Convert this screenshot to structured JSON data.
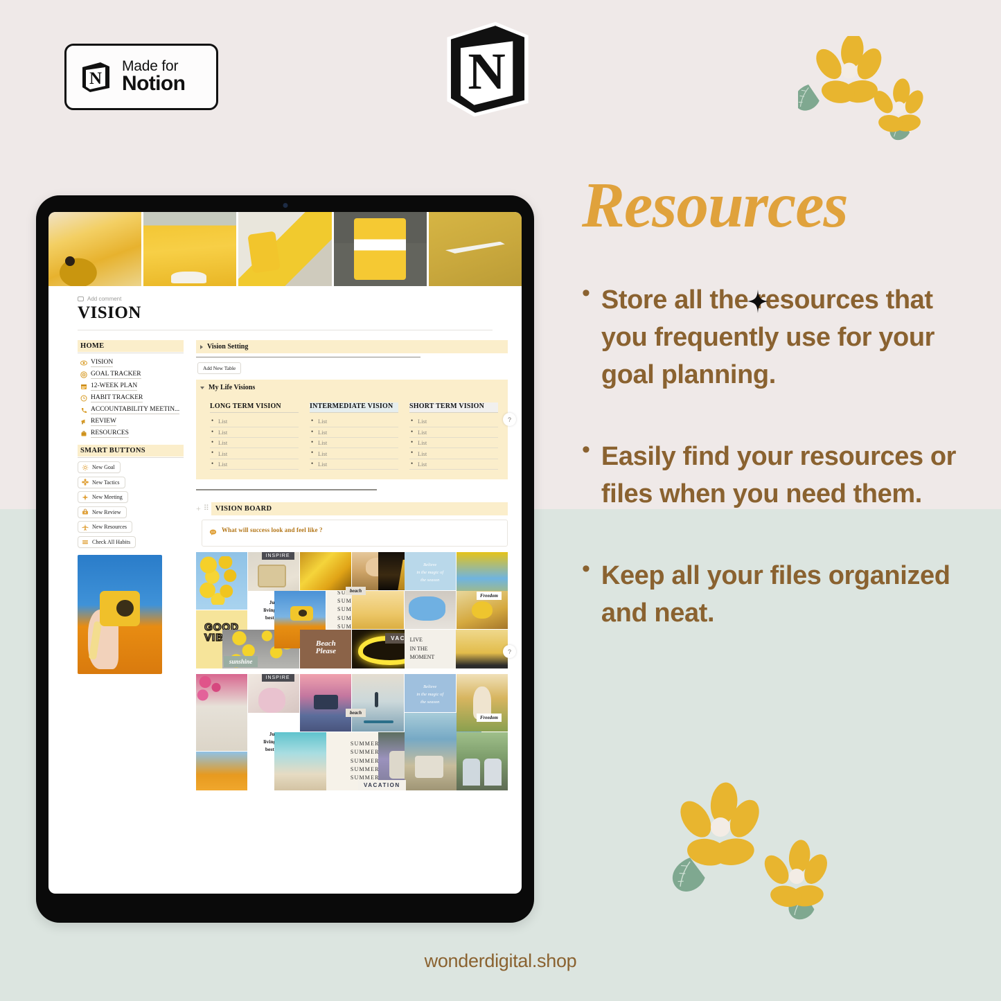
{
  "badge": {
    "line1": "Made for",
    "line2": "Notion",
    "icon": "notion-cube-icon"
  },
  "logo": {
    "icon": "notion-logo-icon"
  },
  "decor": {
    "flowers_top": "flower-pair-icon",
    "flowers_bottom": "flower-pair-icon",
    "sparkle": "four-point-star-icon"
  },
  "colors": {
    "bg_top": "#efe9e8",
    "bg_bottom": "#dce5e0",
    "accent_orange": "#e0a23c",
    "text_brown": "#8a6230",
    "notion_highlight": "#fbeecb"
  },
  "tablet": {
    "cover_images": [
      "yellow-ukulele-photo",
      "yellow-sweatshirt-photo",
      "yellow-converse-sneakers-photo",
      "yellow-outfit-photo",
      "nike-yellow-sweater-photo"
    ],
    "page": {
      "add_comment": "Add comment",
      "title": "VISION",
      "sidebar": {
        "home_header": "HOME",
        "nav_items": [
          {
            "label": "VISION",
            "icon": "eye-icon"
          },
          {
            "label": "GOAL TRACKER",
            "icon": "target-icon"
          },
          {
            "label": "12-WEEK PLAN",
            "icon": "calendar-icon"
          },
          {
            "label": "HABIT TRACKER",
            "icon": "clock-icon"
          },
          {
            "label": "ACCOUNTABILITY MEETIN...",
            "icon": "phone-icon"
          },
          {
            "label": "REVIEW",
            "icon": "megaphone-icon"
          },
          {
            "label": "RESOURCES",
            "icon": "briefcase-icon"
          }
        ],
        "smart_buttons_header": "SMART BUTTONS",
        "smart_buttons": [
          {
            "label": "New Goal",
            "icon": "sun-icon"
          },
          {
            "label": "New Tactics",
            "icon": "gear-flower-icon"
          },
          {
            "label": "New Meeting",
            "icon": "sparkle-icon"
          },
          {
            "label": "New Review",
            "icon": "toolbox-icon"
          },
          {
            "label": "New Resources",
            "icon": "airplane-icon"
          },
          {
            "label": "Check All Habits",
            "icon": "stack-icon"
          }
        ],
        "photo": "yellow-instant-camera-photo"
      },
      "vision_setting": {
        "title": "Vision Setting",
        "add_table_button": "Add New Table"
      },
      "my_life_visions": {
        "title": "My Life Visions",
        "columns": [
          {
            "header": "LONG TERM VISION",
            "items": [
              "List",
              "List",
              "List",
              "List",
              "List"
            ]
          },
          {
            "header": "INTERMEDIATE VISION",
            "items": [
              "List",
              "List",
              "List",
              "List",
              "List"
            ]
          },
          {
            "header": "SHORT TERM VISION",
            "items": [
              "List",
              "List",
              "List",
              "List",
              "List"
            ]
          }
        ]
      },
      "vision_board": {
        "title": "VISION BOARD",
        "callout": "What will success look and feel like ?",
        "callout_icon": "speech-bubble-icon",
        "collage1_labels": {
          "inspire": "INSPIRE",
          "beach": "beach",
          "freedom": "Freedom",
          "believe": "Believe\nin the magic of\nthe season",
          "just_living": "Just\nliving my\nbest life",
          "summer": "SUMMER",
          "good_vibes": "GOOD\nVIBES",
          "sunshine": "sunshine",
          "beach_please": "Beach\nPlease",
          "vacation": "VACATION",
          "live_moment": "LIVE\nIN THE\nMOMENT"
        },
        "collage2_labels": {
          "inspire": "INSPIRE",
          "beach": "beach",
          "freedom": "Freedom",
          "believe": "Believe\nin the magic of\nthe season",
          "just_living": "Just\nliving my\nbest life",
          "summer": "SUMMER",
          "vacation": "VACATION"
        }
      },
      "help_bubbles": [
        "?",
        "?"
      ]
    }
  },
  "panel": {
    "title": "Resources",
    "bullets": [
      "Store all the resources that you frequently use for your goal planning.",
      " Easily find your resources or files when you need them.",
      "Keep all your files organized and neat."
    ]
  },
  "footer": {
    "text": "wonderdigital.shop"
  }
}
